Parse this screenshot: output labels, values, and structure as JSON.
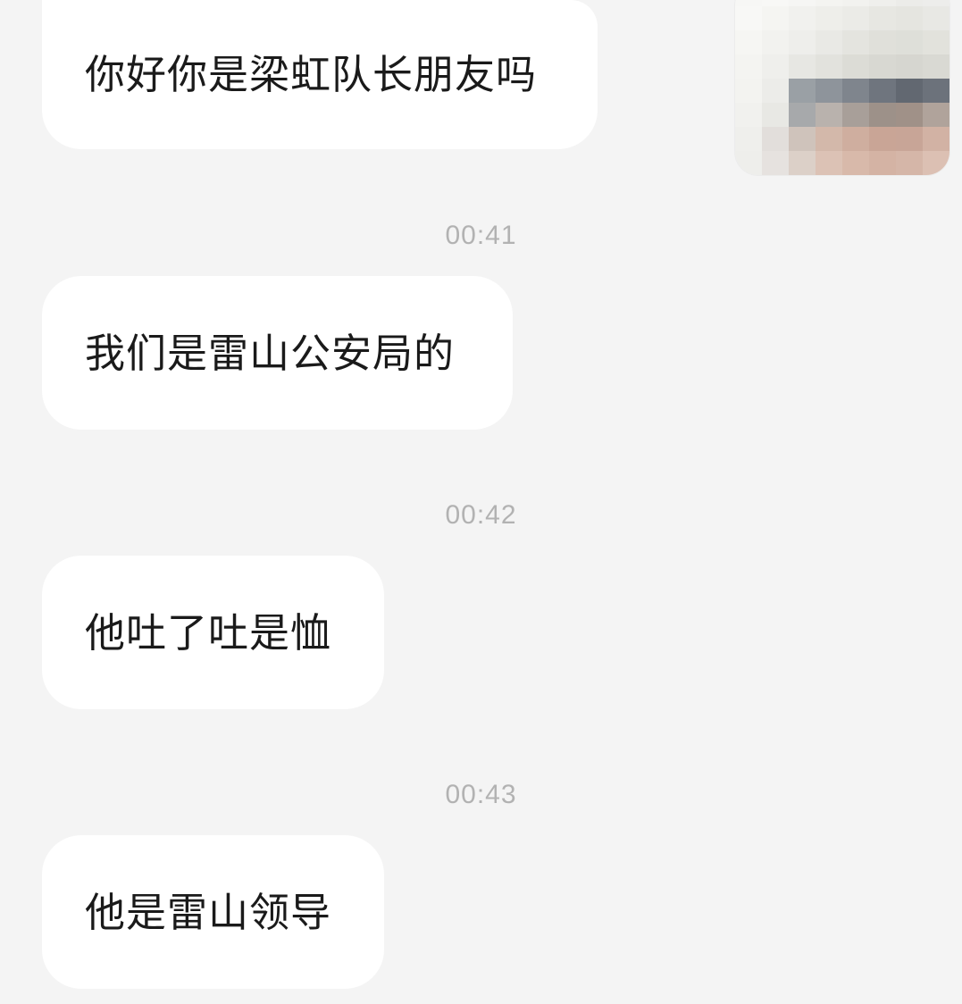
{
  "messages": [
    {
      "text": "你好你是梁虹队长朋友吗"
    },
    {
      "text": "我们是雷山公安局的"
    },
    {
      "text": "他吐了吐是恤"
    },
    {
      "text": "他是雷山领导"
    }
  ],
  "timestamps": [
    "00:41",
    "00:42",
    "00:43"
  ],
  "avatar": {
    "icon": "pixelated-avatar-image",
    "pixels": [
      "#f7f7f5",
      "#f8f8f6",
      "#f6f6f4",
      "#f4f4f1",
      "#f2f2ef",
      "#efefec",
      "#ecece9",
      "#ededeb",
      "#f8f8f6",
      "#f5f5f2",
      "#f1f1ee",
      "#eeeeea",
      "#ebebe7",
      "#e7e7e2",
      "#e5e5e0",
      "#e8e8e4",
      "#f6f6f3",
      "#f2f2ef",
      "#eeeeeb",
      "#e9e9e5",
      "#e4e4df",
      "#e0e0da",
      "#dedfd9",
      "#e2e2dc",
      "#f4f4f1",
      "#efefec",
      "#e7e7e3",
      "#e2e2dd",
      "#dcdcd6",
      "#d8d8d2",
      "#d6d6d0",
      "#d9d9d3",
      "#f3f3f0",
      "#ecece9",
      "#9aa0a5",
      "#8e949b",
      "#7f858d",
      "#6f757e",
      "#626871",
      "#6c727b",
      "#f1f1ee",
      "#e8e8e4",
      "#a7a9ab",
      "#b9b2ad",
      "#a89f99",
      "#9d9189",
      "#a09188",
      "#b0a39b",
      "#efefec",
      "#e2dedb",
      "#cfc3bb",
      "#d3b8aa",
      "#cfae9f",
      "#c9a596",
      "#c8a597",
      "#d2b2a4",
      "#eeeeeb",
      "#e6e2df",
      "#dcd0c8",
      "#dcc2b5",
      "#d8b9aa",
      "#d4b3a4",
      "#d5b6a8",
      "#dcc0b3"
    ]
  }
}
